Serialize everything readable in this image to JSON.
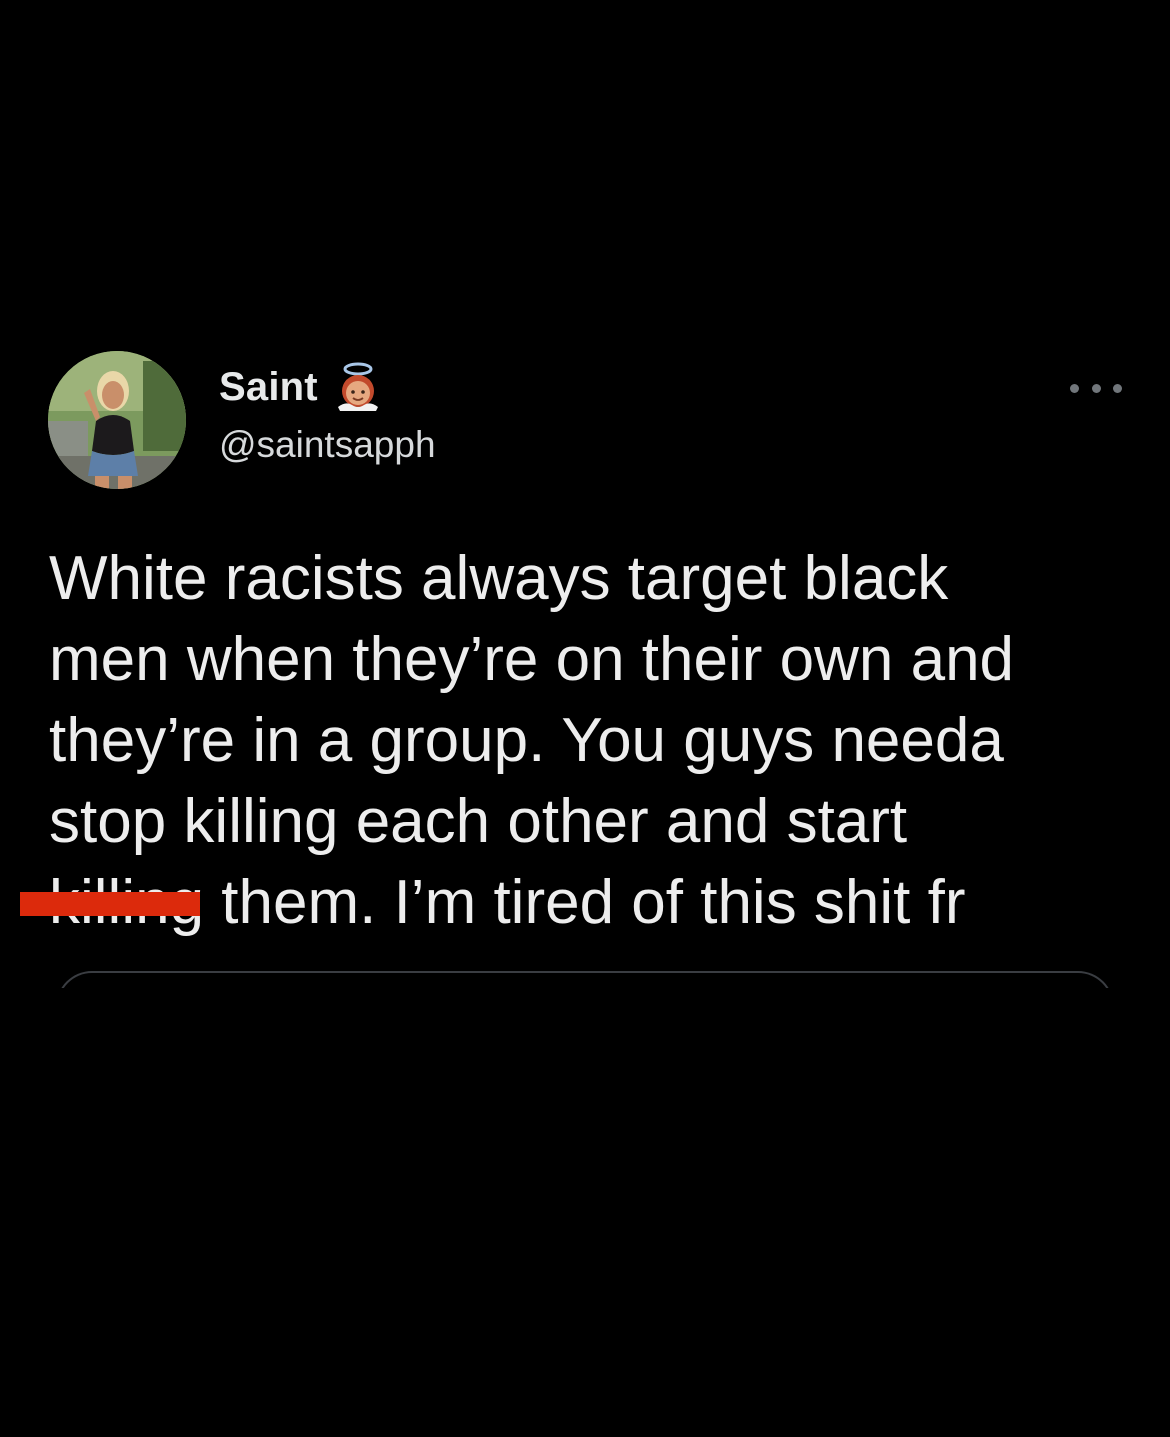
{
  "tweet": {
    "author": {
      "display_name": "Saint",
      "name_emoji": "angel-face-emoji",
      "handle": "@saintsapph",
      "avatar": "profile-photo"
    },
    "more_icon": "more-horizontal-icon",
    "text_lines": [
      "White racists always target black",
      "men when they’re on their own and",
      "they’re in a group. You guys needa",
      "stop killing each other and start",
      " them. I’m tired of this shit fr"
    ],
    "redacted_word": "killing",
    "colors": {
      "background": "#000000",
      "text": "#e7e9ea",
      "secondary_text": "#d6d9db",
      "redaction": "#dc2a0c",
      "card_border": "#3a3d42"
    }
  }
}
